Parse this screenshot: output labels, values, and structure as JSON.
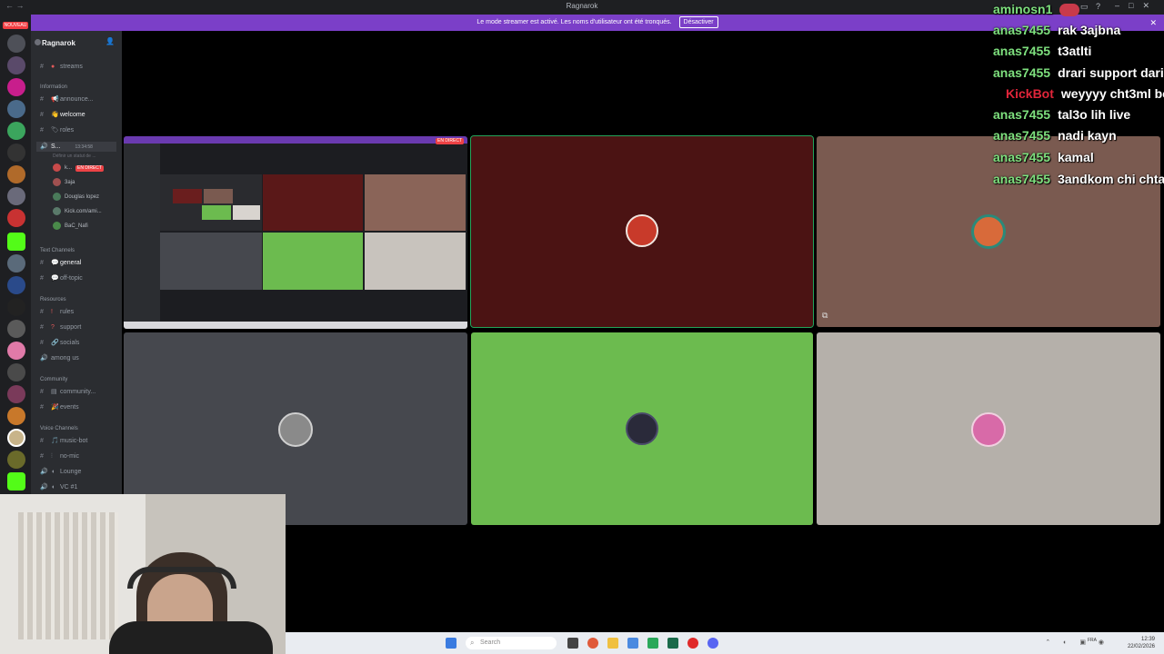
{
  "window": {
    "title": "Ragnarok"
  },
  "banner": {
    "text": "Le mode streamer est activé. Les noms d'utilisateur ont été tronqués.",
    "button": "Désactiver"
  },
  "rail": {
    "new_badge": "NOUVEAU"
  },
  "server": {
    "name": "Ragnarok",
    "channels_top": [
      {
        "label": "streams"
      }
    ],
    "categories": {
      "information": "Information",
      "text": "Text Channels",
      "resources": "Resources",
      "community": "Community",
      "voice": "Voice Channels"
    },
    "information": [
      {
        "label": "announce..."
      },
      {
        "label": "welcome"
      },
      {
        "label": "roles"
      }
    ],
    "stage": {
      "label": "S...",
      "time": "13:34:58",
      "status": "Définir un statut de ..."
    },
    "voice_users": [
      {
        "name": "k...",
        "live": "EN DIRECT"
      },
      {
        "name": "3aja"
      },
      {
        "name": "Douglas lopez"
      },
      {
        "name": "Kick.com/ami..."
      },
      {
        "name": "BaC_Nafi"
      }
    ],
    "text_channels": [
      {
        "label": "general"
      },
      {
        "label": "off-topic"
      }
    ],
    "resources": [
      {
        "label": "rules"
      },
      {
        "label": "support"
      },
      {
        "label": "socials"
      },
      {
        "label": "among us"
      }
    ],
    "community": [
      {
        "label": "community..."
      },
      {
        "label": "events"
      }
    ],
    "voice_channels": [
      {
        "label": "music-bot"
      },
      {
        "label": "no-mic"
      },
      {
        "label": "Lounge"
      },
      {
        "label": "VC #1"
      }
    ]
  },
  "stream_preview": {
    "live": "EN DIRECT"
  },
  "chat": [
    {
      "user": "aminosn1",
      "msg": ""
    },
    {
      "user": "anas7455",
      "msg": "rak 3ajbna"
    },
    {
      "user": "anas7455",
      "msg": "t3atlti"
    },
    {
      "user": "anas7455",
      "msg": "drari support dari"
    },
    {
      "user": "KickBot",
      "msg": "weyyyy cht3ml bo"
    },
    {
      "user": "anas7455",
      "msg": "tal3o lih live"
    },
    {
      "user": "anas7455",
      "msg": "nadi kayn"
    },
    {
      "user": "anas7455",
      "msg": "kamal"
    },
    {
      "user": "anas7455",
      "msg": "3andkom chi chta"
    }
  ],
  "taskbar": {
    "search_placeholder": "Search",
    "time": "12:39",
    "date": "22/02/2026",
    "lang": "FRA"
  },
  "colors": {
    "discord_purple": "#7b3fc8",
    "chat_user": "#7ee07e",
    "bot": "#e0253a"
  }
}
